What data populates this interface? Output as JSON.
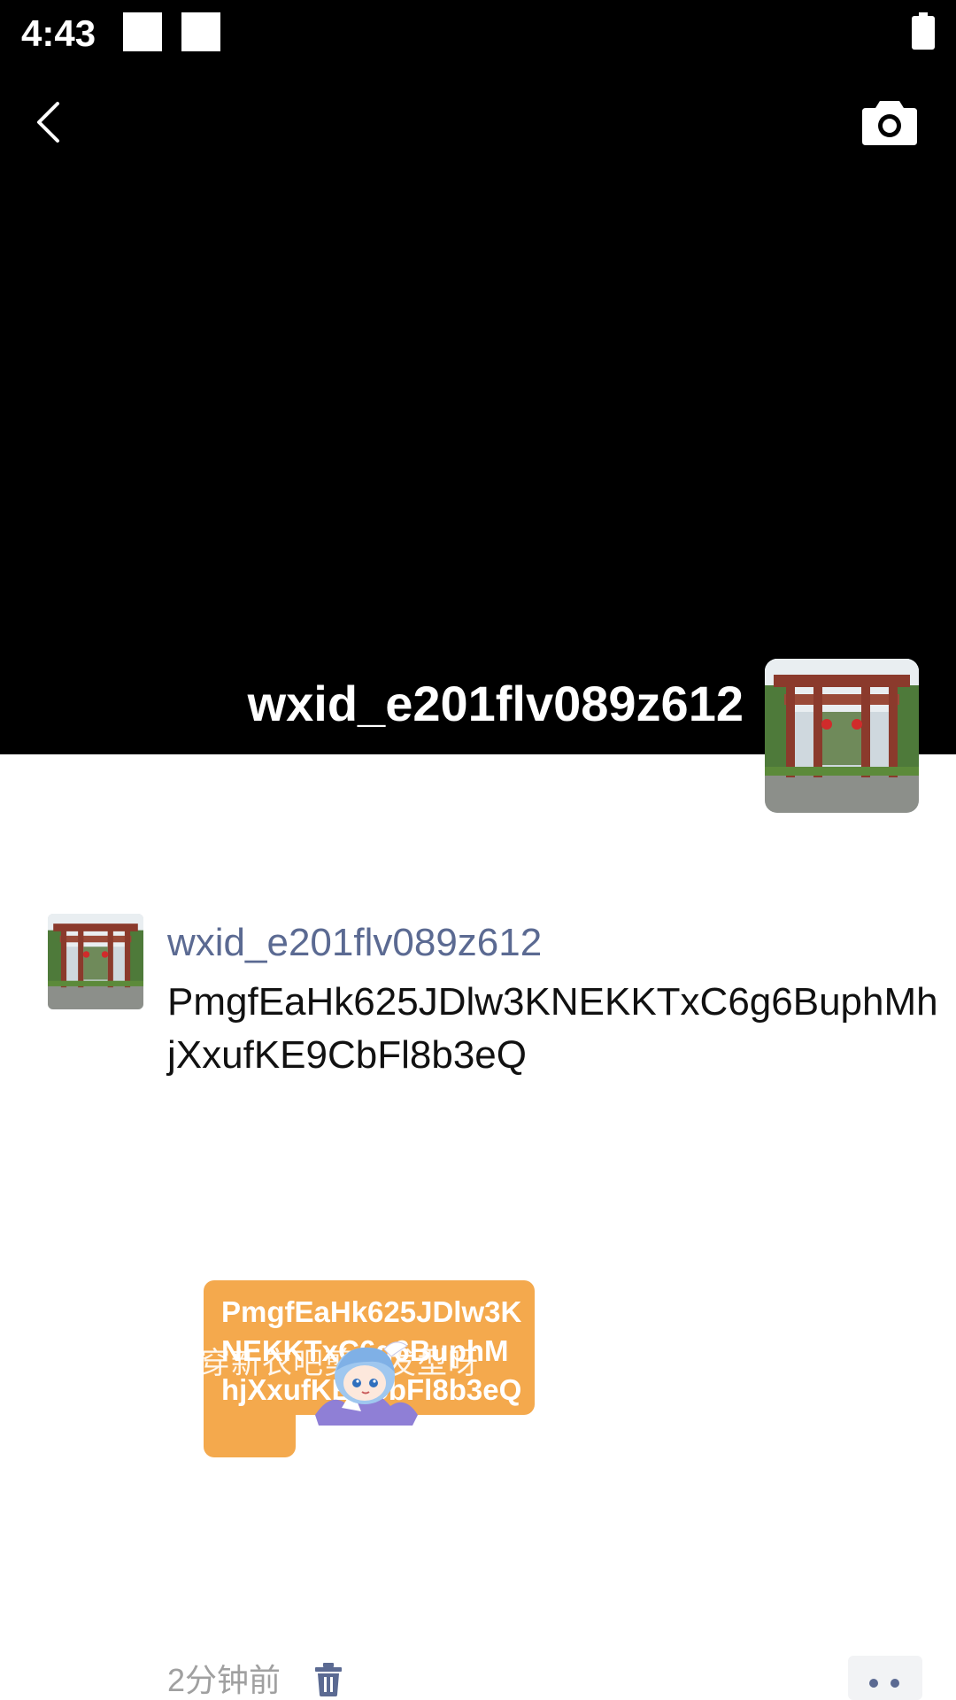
{
  "status_bar": {
    "time": "4:43"
  },
  "header": {
    "back_icon": "chevron-left-icon",
    "camera_icon": "camera-icon"
  },
  "cover": {
    "username": "wxid_e201flv089z612",
    "avatar_image": "archway-photo"
  },
  "post": {
    "username": "wxid_e201flv089z612",
    "text": "PmgfEaHk625JDlw3KNEKKTxC6g6BuphMhjXxufKE9CbFl8b3eQ",
    "sticker": {
      "text": "PmgfEaHk625JDlw3KNEKKTxC6g6BuphMhjXxufKE9CbFl8b3eQ",
      "overlay_text": "穿新衣吧剪新发型呀",
      "character": "anime-character-sticker"
    },
    "timestamp": "2分钟前",
    "delete_icon": "trash-icon",
    "more_icon": "more-dots-icon"
  },
  "colors": {
    "cover_background": "#000000",
    "link_username": "#5b6a92",
    "sticker_background": "#f4a94d",
    "timestamp": "#a0a0a0"
  }
}
